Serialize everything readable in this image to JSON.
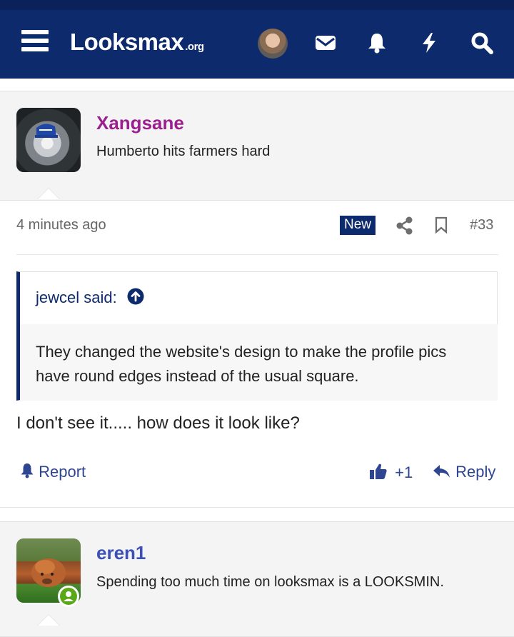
{
  "header": {
    "logo_main": "Looksmax",
    "logo_tld": ".org",
    "icons": [
      "menu-icon",
      "user-avatar",
      "envelope-icon",
      "bell-icon",
      "bolt-icon",
      "search-icon"
    ]
  },
  "colors": {
    "brand": "#0d2a6c",
    "username_purple": "#9b1f8f",
    "username_blue": "#3c51b8",
    "link": "#2e4591",
    "online": "#5aa816"
  },
  "posts": [
    {
      "username": "Xangsane",
      "user_title": "Humberto hits farmers hard",
      "time": "4 minutes ago",
      "badge": "New",
      "post_number": "#33",
      "quote": {
        "author_line": "jewcel said:",
        "text": "They changed the website's design to make the profile pics have round edges instead of the usual square."
      },
      "message": "I don't see it..... how does it look like?",
      "actions": {
        "report": "Report",
        "reaction_count": "+1",
        "reply": "Reply"
      }
    },
    {
      "username": "eren1",
      "user_title": "Spending too much time on looksmax is a LOOKSMIN."
    }
  ]
}
